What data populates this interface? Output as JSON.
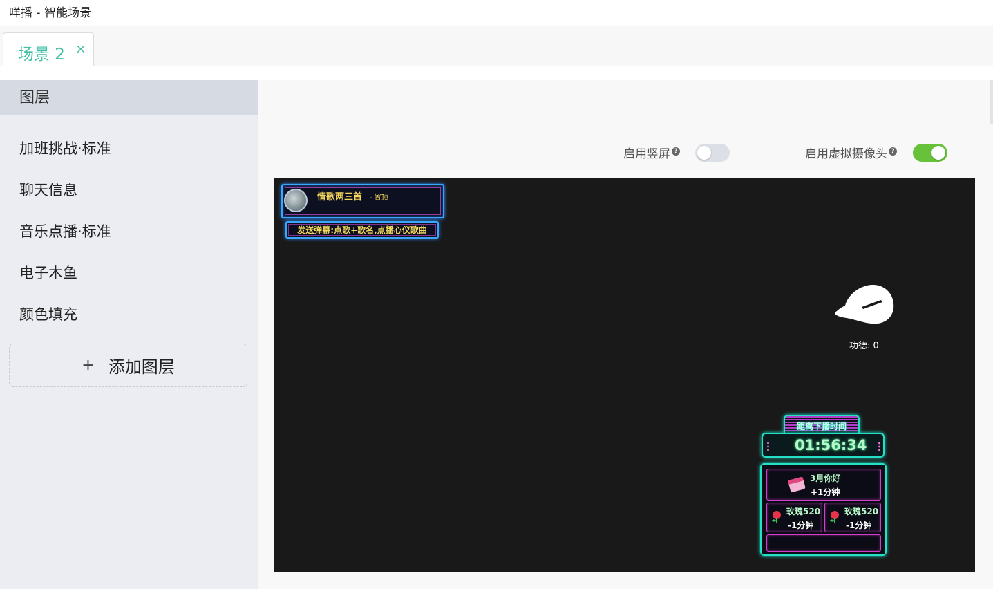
{
  "window": {
    "title": "咩播 - 智能场景"
  },
  "tabs": [
    {
      "label": "场景 2",
      "close_glyph": "×"
    }
  ],
  "sidebar": {
    "header": "图层",
    "layers": [
      "加班挑战·标准",
      "聊天信息",
      "音乐点播·标准",
      "电子木鱼",
      "颜色填充"
    ],
    "add_button": {
      "icon": "+",
      "label": "添加图层"
    }
  },
  "options": {
    "vertical": {
      "label": "启用竖屏",
      "help": "?",
      "enabled": false
    },
    "virtual_camera": {
      "label": "启用虚拟摄像头",
      "help": "?",
      "enabled": true
    }
  },
  "colors": {
    "accent": "#3fbfa4",
    "toggle_on": "#67c23a",
    "toggle_off": "#dcdfe6",
    "canvas_bg": "#191919"
  },
  "canvas": {
    "song_widget": {
      "song_title": "情歌两三首",
      "tag": "- 置顶",
      "hint": "发送弹幕:点歌+歌名,点播心仪歌曲"
    },
    "wooden_fish": {
      "merit_label": "功德: 0",
      "icon": "wooden-fish-icon"
    },
    "countdown": {
      "header": "距离下播时间",
      "time": "01:56:34",
      "gifts": [
        {
          "name": "3月你好",
          "effect": "+1分钟",
          "icon": "calendar-gift-icon"
        },
        {
          "name": "玫瑰520",
          "effect": "-1分钟",
          "icon": "rose-icon"
        },
        {
          "name": "玫瑰520",
          "effect": "-1分钟",
          "icon": "rose-icon"
        }
      ]
    }
  }
}
